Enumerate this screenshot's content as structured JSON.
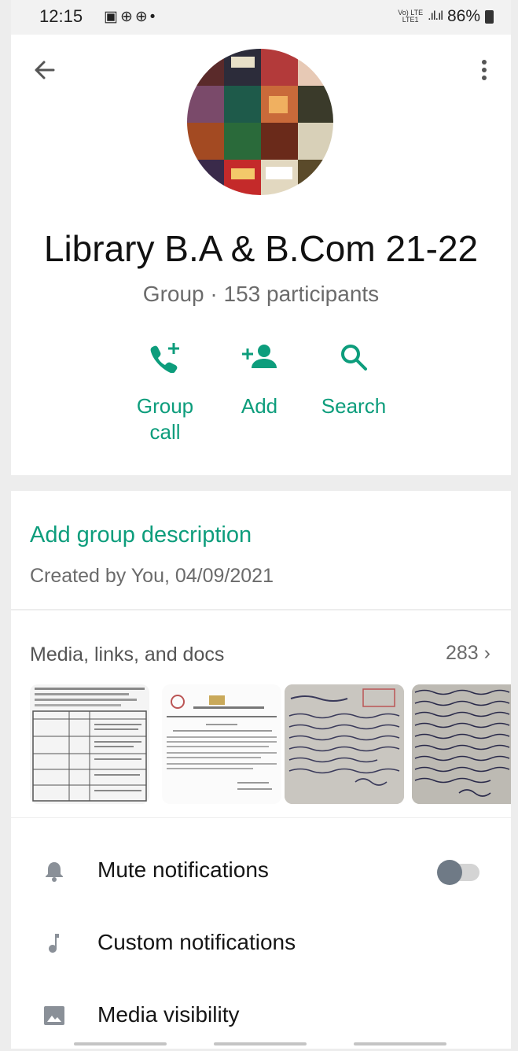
{
  "status_bar": {
    "time": "12:15",
    "notification_icons": "▣⊕⊕•",
    "network": "Vo) LTE LTE1",
    "battery": "86%"
  },
  "header": {
    "group_name": "Library B.A & B.Com 21-22",
    "subtitle": "Group · 153 participants",
    "actions": [
      {
        "icon": "group-call-icon",
        "label": "Group\ncall"
      },
      {
        "icon": "add-person-icon",
        "label": "Add"
      },
      {
        "icon": "search-icon",
        "label": "Search"
      }
    ]
  },
  "description": {
    "add_label": "Add group description",
    "created": "Created by You, 04/09/2021"
  },
  "media": {
    "title": "Media, links, and docs",
    "count": "283",
    "thumbnails": [
      "printed-table-document",
      "printed-letter-document",
      "handwritten-note",
      "handwritten-page"
    ]
  },
  "settings": [
    {
      "icon": "bell-icon",
      "label": "Mute notifications",
      "toggle": false
    },
    {
      "icon": "music-note-icon",
      "label": "Custom notifications"
    },
    {
      "icon": "image-icon",
      "label": "Media visibility"
    }
  ],
  "colors": {
    "accent": "#0d9d7c",
    "background": "#ededed",
    "secondary_text": "#6b6b6b"
  }
}
